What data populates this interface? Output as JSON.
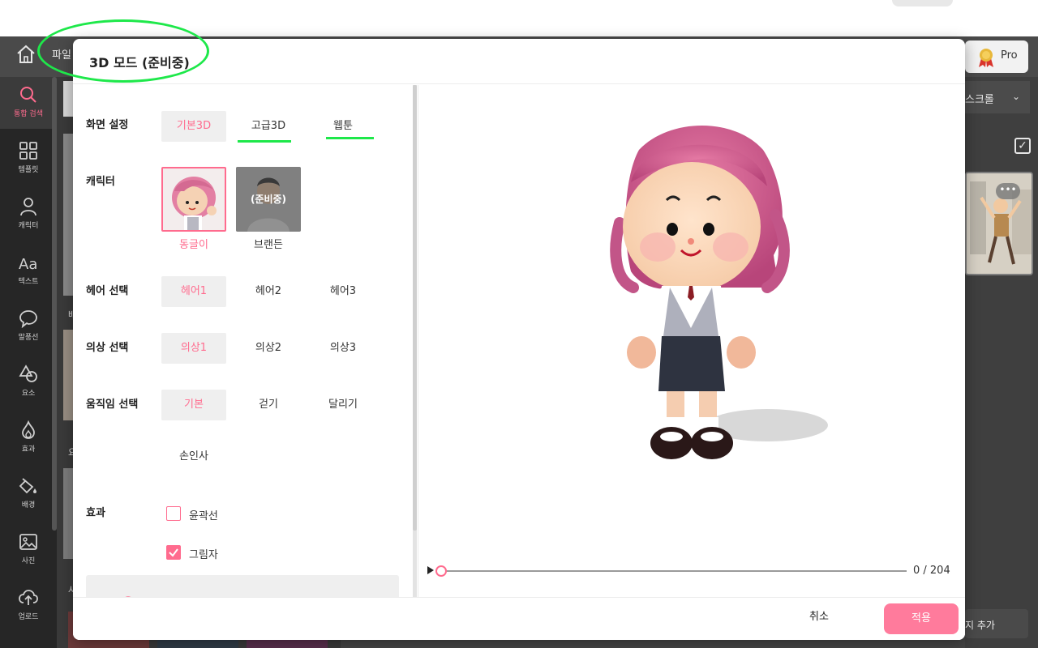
{
  "app": {
    "file_menu": "파일",
    "pro_label": "Pro",
    "sidebar": [
      {
        "label": "통합 검색",
        "icon": "search-icon",
        "active": true
      },
      {
        "label": "템플릿",
        "icon": "grid-icon"
      },
      {
        "label": "캐릭터",
        "icon": "person-icon"
      },
      {
        "label": "텍스트",
        "icon": "text-icon"
      },
      {
        "label": "말풍선",
        "icon": "speech-bubble-icon"
      },
      {
        "label": "요소",
        "icon": "shapes-icon"
      },
      {
        "label": "효과",
        "icon": "flame-icon"
      },
      {
        "label": "배경",
        "icon": "paint-bucket-icon"
      },
      {
        "label": "사진",
        "icon": "photo-icon"
      },
      {
        "label": "업로드",
        "icon": "upload-cloud-icon"
      }
    ],
    "panel_fragments": [
      "배",
      "요",
      "사"
    ],
    "right_panel": {
      "scroll_select": "스크롤",
      "add_page": "지 추가",
      "more": "•••"
    }
  },
  "modal": {
    "title": "3D 모드 (준비중)",
    "sections": {
      "screen": {
        "label": "화면 설정",
        "options": [
          "기본3D",
          "고급3D",
          "웹툰"
        ],
        "selected": 0
      },
      "character": {
        "label": "캐릭터",
        "items": [
          {
            "name": "동글이",
            "selected": true
          },
          {
            "name": "브랜든",
            "overlay": "(준비중)"
          }
        ]
      },
      "hair": {
        "label": "헤어 선택",
        "options": [
          "헤어1",
          "헤어2",
          "헤어3"
        ],
        "selected": 0
      },
      "outfit": {
        "label": "의상 선택",
        "options": [
          "의상1",
          "의상2",
          "의상3"
        ],
        "selected": 0
      },
      "motion": {
        "label": "움직임 선택",
        "options": [
          "기본",
          "걷기",
          "달리기",
          "손인사"
        ],
        "selected": 0
      },
      "effect": {
        "label": "효과",
        "items": [
          {
            "label": "윤곽선",
            "checked": false
          },
          {
            "label": "그림자",
            "checked": true
          }
        ]
      }
    },
    "timeline": {
      "current": 0,
      "total": 204,
      "text": "0 / 204"
    },
    "footer": {
      "cancel": "취소",
      "apply": "적용"
    }
  },
  "colors": {
    "accent": "#ff6b8e",
    "apply_button": "#ff7b9c",
    "annotation": "#1ee84a"
  }
}
